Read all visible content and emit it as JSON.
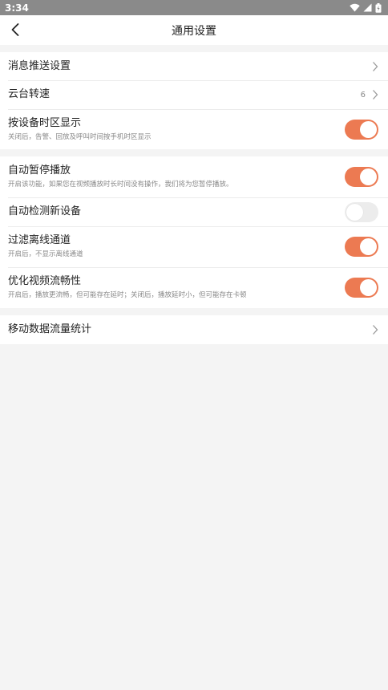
{
  "status_bar": {
    "time": "3:34"
  },
  "header": {
    "title": "通用设置"
  },
  "colors": {
    "accent": "#ec7a52",
    "toggle_off": "#ececec",
    "background": "#f4f4f4"
  },
  "groups": [
    {
      "items": [
        {
          "title": "消息推送设置"
        },
        {
          "title": "云台转速",
          "value": "6"
        },
        {
          "title": "按设备时区显示",
          "subtitle": "关闭后，告警、回放及呼叫时间按手机时区显示",
          "toggle": true
        }
      ]
    },
    {
      "items": [
        {
          "title": "自动暂停播放",
          "subtitle": "开启该功能，如果您在视频播放时长时间没有操作，我们将为您暂停播放。",
          "toggle": true
        },
        {
          "title": "自动检测新设备",
          "toggle": false
        },
        {
          "title": "过滤离线通道",
          "subtitle": "开启后，不显示离线通道",
          "toggle": true
        },
        {
          "title": "优化视频流畅性",
          "subtitle": "开启后，播放更流畅，但可能存在延时；关闭后，播放延时小，但可能存在卡顿",
          "toggle": true
        }
      ]
    },
    {
      "items": [
        {
          "title": "移动数据流量统计"
        }
      ]
    }
  ]
}
